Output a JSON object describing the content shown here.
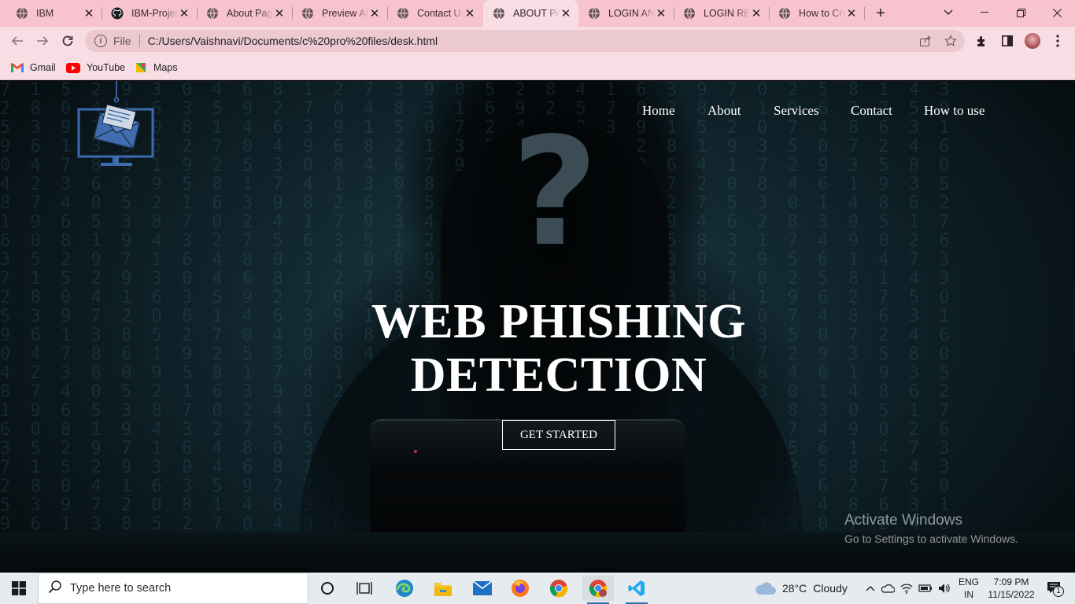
{
  "browser": {
    "tabs": [
      {
        "title": "IBM",
        "favicon": "globe-icon",
        "active": false
      },
      {
        "title": "IBM-Project",
        "favicon": "github-icon",
        "active": false
      },
      {
        "title": "About Page",
        "favicon": "globe-icon",
        "active": false
      },
      {
        "title": "Preview About",
        "favicon": "globe-icon",
        "active": false
      },
      {
        "title": "Contact Us",
        "favicon": "globe-icon",
        "active": false
      },
      {
        "title": "ABOUT PAGE",
        "favicon": "globe-icon",
        "active": true
      },
      {
        "title": "LOGIN AND",
        "favicon": "globe-icon",
        "active": false
      },
      {
        "title": "LOGIN REG",
        "favicon": "globe-icon",
        "active": false
      },
      {
        "title": "How to Cre",
        "favicon": "globe-icon",
        "active": false
      }
    ],
    "address": {
      "scheme": "File",
      "url": "C:/Users/Vaishnavi/Documents/c%20pro%20files/desk.html"
    },
    "bookmarks": [
      {
        "label": "Gmail",
        "icon": "gmail-icon"
      },
      {
        "label": "YouTube",
        "icon": "youtube-icon"
      },
      {
        "label": "Maps",
        "icon": "maps-icon"
      }
    ],
    "colors": {
      "tabstrip": "#f7c3cf",
      "toolbar": "#f8dde4"
    }
  },
  "site": {
    "nav": [
      "Home",
      "About",
      "Services",
      "Contact",
      "How to use"
    ],
    "hero_title_line1": "WEB PHISHING",
    "hero_title_line2": "DETECTION",
    "cta_label": "GET STARTED",
    "logo_icon": "phishing-monitor-logo-icon"
  },
  "watermark": {
    "line1": "Activate Windows",
    "line2": "Go to Settings to activate Windows."
  },
  "taskbar": {
    "search_placeholder": "Type here to search",
    "weather": {
      "temp": "28°C",
      "condition": "Cloudy"
    },
    "lang": {
      "top": "ENG",
      "bottom": "IN"
    },
    "time": "7:09 PM",
    "date": "11/15/2022",
    "notifications": "1",
    "apps": [
      "cortana-icon",
      "task-view-icon",
      "edge-icon",
      "file-explorer-icon",
      "mail-icon",
      "firefox-icon",
      "chrome-icon",
      "chrome-profile-icon",
      "vscode-icon"
    ]
  }
}
